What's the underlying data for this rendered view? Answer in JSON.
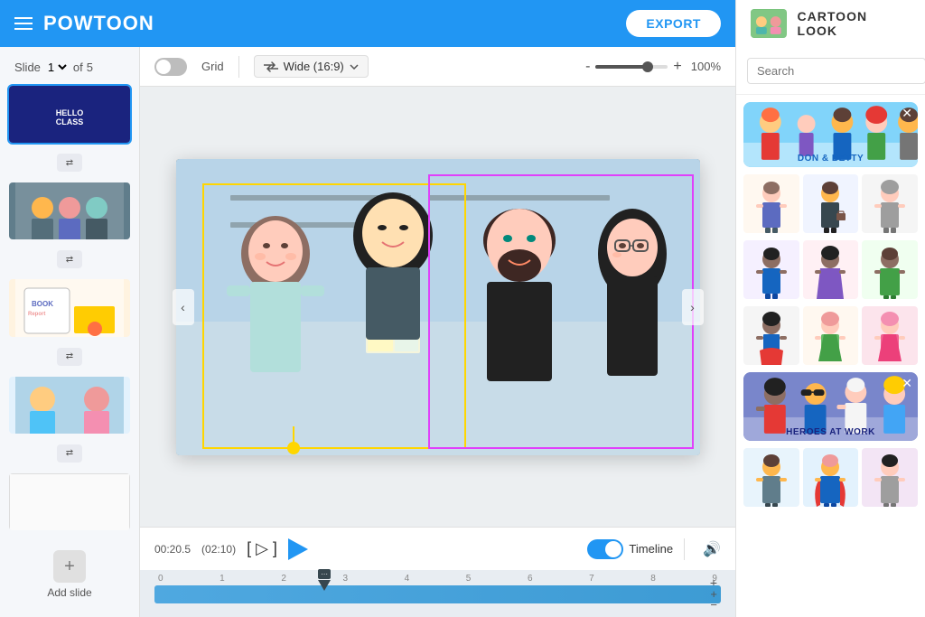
{
  "app": {
    "logo": "POWTOON",
    "export_label": "EXPORT"
  },
  "right_header": {
    "title": "CARTOON LOOK"
  },
  "toolbar": {
    "grid_label": "Grid",
    "aspect_label": "Wide (16:9)",
    "zoom_value": "100%",
    "zoom_min": "-",
    "zoom_max": "+"
  },
  "sidebar": {
    "slide_label": "Slide",
    "slide_num": "1",
    "of_label": "of",
    "total_slides": "5",
    "add_slide_label": "Add slide"
  },
  "slides": [
    {
      "id": 1,
      "type": "hello_class",
      "active": true
    },
    {
      "id": 2,
      "type": "people",
      "active": false
    },
    {
      "id": 3,
      "type": "book_report",
      "active": false
    },
    {
      "id": 4,
      "type": "photo",
      "active": false
    },
    {
      "id": 5,
      "type": "blank",
      "active": false
    }
  ],
  "playback": {
    "time_current": "00:20.5",
    "time_total": "(02:10)",
    "timeline_label": "Timeline"
  },
  "timeline": {
    "ruler_marks": [
      "0",
      "1",
      "2",
      "3",
      "4",
      "5",
      "6",
      "7",
      "8",
      "9"
    ],
    "zoom_plus": "+",
    "zoom_minus": "-"
  },
  "search": {
    "placeholder": "Search"
  },
  "packs": [
    {
      "id": "don_betty",
      "label": "DON & BETTY",
      "type": "featured"
    },
    {
      "id": "heroes_at_work",
      "label": "HEROES AT WORK",
      "type": "featured"
    }
  ],
  "character_rows": [
    [
      "f1",
      "f2",
      "f3"
    ],
    [
      "m1",
      "m2",
      "m3"
    ],
    [
      "f4",
      "f5",
      "f6"
    ],
    [
      "m4",
      "m5",
      "m6"
    ],
    [
      "f7",
      "f8",
      "f9"
    ]
  ]
}
